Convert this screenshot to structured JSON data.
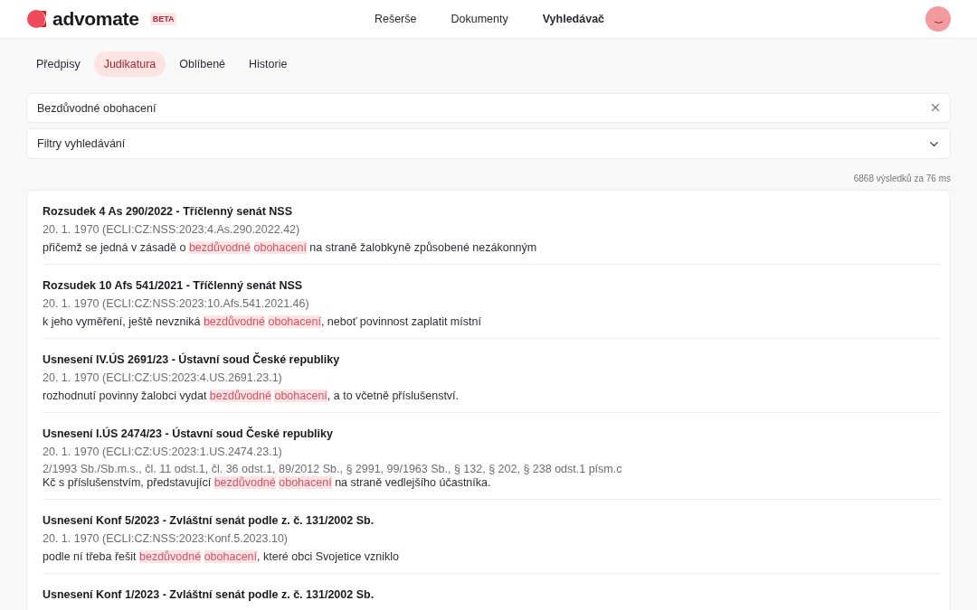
{
  "header": {
    "logo_text": "advomate",
    "badge": "BETA",
    "nav": [
      {
        "label": "Rešerše",
        "selected": false
      },
      {
        "label": "Dokumenty",
        "selected": false
      },
      {
        "label": "Vyhledávač",
        "selected": true
      }
    ]
  },
  "tabs": [
    {
      "label": "Předpisy",
      "selected": false
    },
    {
      "label": "Judikatura",
      "selected": true
    },
    {
      "label": "Oblíbené",
      "selected": false
    },
    {
      "label": "Historie",
      "selected": false
    }
  ],
  "search": {
    "value": "Bezdůvodné obohacení"
  },
  "filters": {
    "label": "Filtry vyhledávání",
    "expanded": false
  },
  "result_count": "6868 výsledků za 76 ms",
  "results": [
    {
      "title": "Rozsudek 4 As 290/2022 - Tříčlenný senát NSS",
      "date": "20. 1. 1970 (ECLI:CZ:NSS:2023:4.As.290.2022.42)",
      "snippet": {
        "before": "přičemž se jedná v zásadě o ",
        "highlights": [
          "bezdůvodné",
          "obohacení"
        ],
        "after": " na straně žalobkyně způsobené nezákonným"
      }
    },
    {
      "title": "Rozsudek 10 Afs 541/2021 - Tříčlenný senát NSS",
      "date": "20. 1. 1970 (ECLI:CZ:NSS:2023:10.Afs.541.2021.46)",
      "snippet": {
        "before": "k jeho vyměření, ještě nevzniká ",
        "highlights": [
          "bezdůvodné",
          "obohacení"
        ],
        "after": ", neboť povinnost zaplatit místní"
      }
    },
    {
      "title": "Usnesení IV.ÚS 2691/23 - Ústavní soud České republiky",
      "date": "20. 1. 1970 (ECLI:CZ:US:2023:4.US.2691.23.1)",
      "snippet": {
        "before": "rozhodnutí povinny žalobci vydat ",
        "highlights": [
          "bezdůvodné",
          "obohacení"
        ],
        "after": ", a to včetně příslušenství."
      }
    },
    {
      "title": "Usnesení I.ÚS 2474/23 - Ústavní soud České republiky",
      "date": "20. 1. 1970 (ECLI:CZ:US:2023:1.US.2474.23.1)",
      "refs": "2/1993 Sb./Sb.m.s., čl. 11 odst.1, čl. 36 odst.1, 89/2012 Sb., § 2991, 99/1963 Sb., § 132, § 202, § 238 odst.1 písm.c",
      "snippet": {
        "before": "Kč s příslušenstvím, představující ",
        "highlights": [
          "bezdůvodné",
          "obohacení"
        ],
        "after": " na straně vedlejšího účastníka."
      }
    },
    {
      "title": "Usnesení Konf 5/2023 - Zvláštní senát podle z. č. 131/2002 Sb.",
      "date": "20. 1. 1970 (ECLI:CZ:NSS:2023:Konf.5.2023.10)",
      "snippet": {
        "before": "podle ní třeba řešit ",
        "highlights": [
          "bezdůvodné",
          "obohacení"
        ],
        "after": ", které obci Svojetice vzniklo"
      }
    },
    {
      "title": "Usnesení Konf 1/2023 - Zvláštní senát podle z. č. 131/2002 Sb."
    }
  ]
}
